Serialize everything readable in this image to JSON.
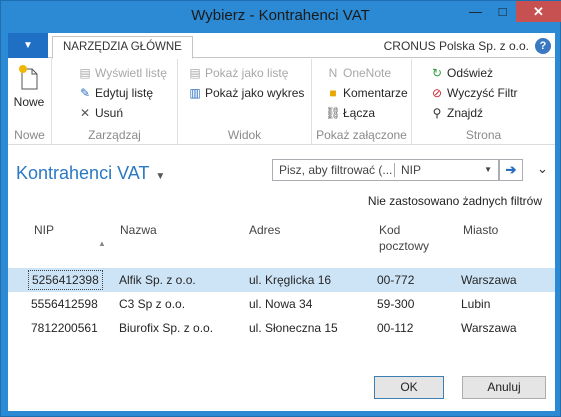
{
  "window": {
    "title": "Wybierz - Kontrahenci VAT",
    "minimize": "—",
    "maximize": "□",
    "close": "✕"
  },
  "ribbon": {
    "app_button": "▼",
    "tab": "NARZĘDZIA GŁÓWNE",
    "company": "CRONUS Polska Sp. z o.o.",
    "help": "?",
    "groups": {
      "nowe": {
        "label": "Nowe",
        "new_button": "Nowe"
      },
      "zarzadzaj": {
        "label": "Zarządzaj",
        "view": "Wyświetl listę",
        "edit": "Edytuj listę",
        "delete": "Usuń"
      },
      "widok": {
        "label": "Widok",
        "show_list": "Pokaż jako listę",
        "show_chart": "Pokaż jako wykres"
      },
      "zalaczone": {
        "label": "Pokaż załączone",
        "onenote": "OneNote",
        "notes": "Komentarze",
        "links": "Łącza"
      },
      "strona": {
        "label": "Strona",
        "refresh": "Odśwież",
        "clear_filter": "Wyczyść Filtr",
        "find": "Znajdź"
      }
    }
  },
  "page": {
    "title": "Kontrahenci VAT",
    "filter_placeholder": "Pisz, aby filtrować (...",
    "filter_field": "NIP",
    "no_filters": "Nie zastosowano żadnych filtrów"
  },
  "table": {
    "columns": [
      "NIP",
      "Nazwa",
      "Adres",
      "Kod pocztowy",
      "Miasto"
    ],
    "rows": [
      [
        "5256412398",
        "Alfik Sp. z o.o.",
        "ul. Kręglicka 16",
        "00-772",
        "Warszawa"
      ],
      [
        "5556412598",
        "C3 Sp z o.o.",
        "ul. Nowa 34",
        "59-300",
        "Lubin"
      ],
      [
        "7812200561",
        "Biurofix Sp. z o.o.",
        "ul. Słoneczna 15",
        "00-112",
        "Warszawa"
      ]
    ]
  },
  "footer": {
    "ok": "OK",
    "cancel": "Anuluj"
  },
  "colors": {
    "accent": "#2b8ad3",
    "selection": "#cde4f7",
    "heading": "#2b78c5"
  }
}
